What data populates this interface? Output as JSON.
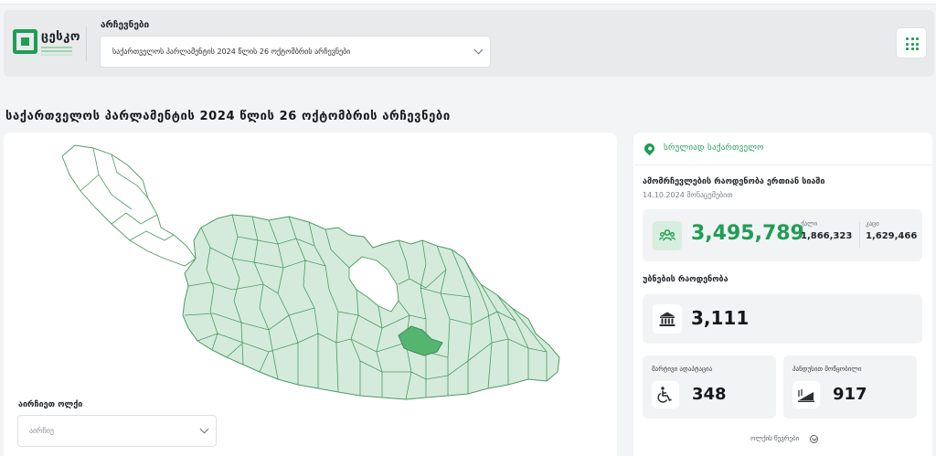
{
  "header": {
    "logo_text": "ცესკო",
    "elections_label": "არჩევნები",
    "elections_select_value": "საქართველოს პარლამენტის 2024 წლის 26 ოქტომბრის არჩევნები",
    "apps_icon": "grid-icon"
  },
  "page_title": "საქართველოს პარლამენტის 2024 წლის 26 ოქტომბრის არჩევნები",
  "map": {
    "region_label": "აირჩიეთ ოლქი",
    "region_placeholder": "აირჩიე",
    "colors": {
      "region_fill": "#d4ebdb",
      "highlight_fill": "#54b571",
      "stroke": "#4c9a64",
      "uncovered_fill": "#ffffff"
    }
  },
  "stats": {
    "location": "სრულიად საქართველო",
    "voters_title": "ამომრჩევლების რაოდენობა ერთიან სიაში",
    "voters_date": "14.10.2024 მონაცემებით",
    "voters_total": "3,495,789",
    "female_label": "ქალი",
    "female_value": "1,866,323",
    "male_label": "კაცი",
    "male_value": "1,629,466",
    "precincts_title": "უბნების რაოდენობა",
    "precincts_total": "3,111",
    "adapted_title": "მარტივი ადაპტაცია",
    "adapted_total": "348",
    "ramp_title": "პანდუსით მოწყობილი",
    "ramp_total": "917",
    "more_link": "ოლქის წევრები",
    "accent_color": "#1f9d55"
  }
}
